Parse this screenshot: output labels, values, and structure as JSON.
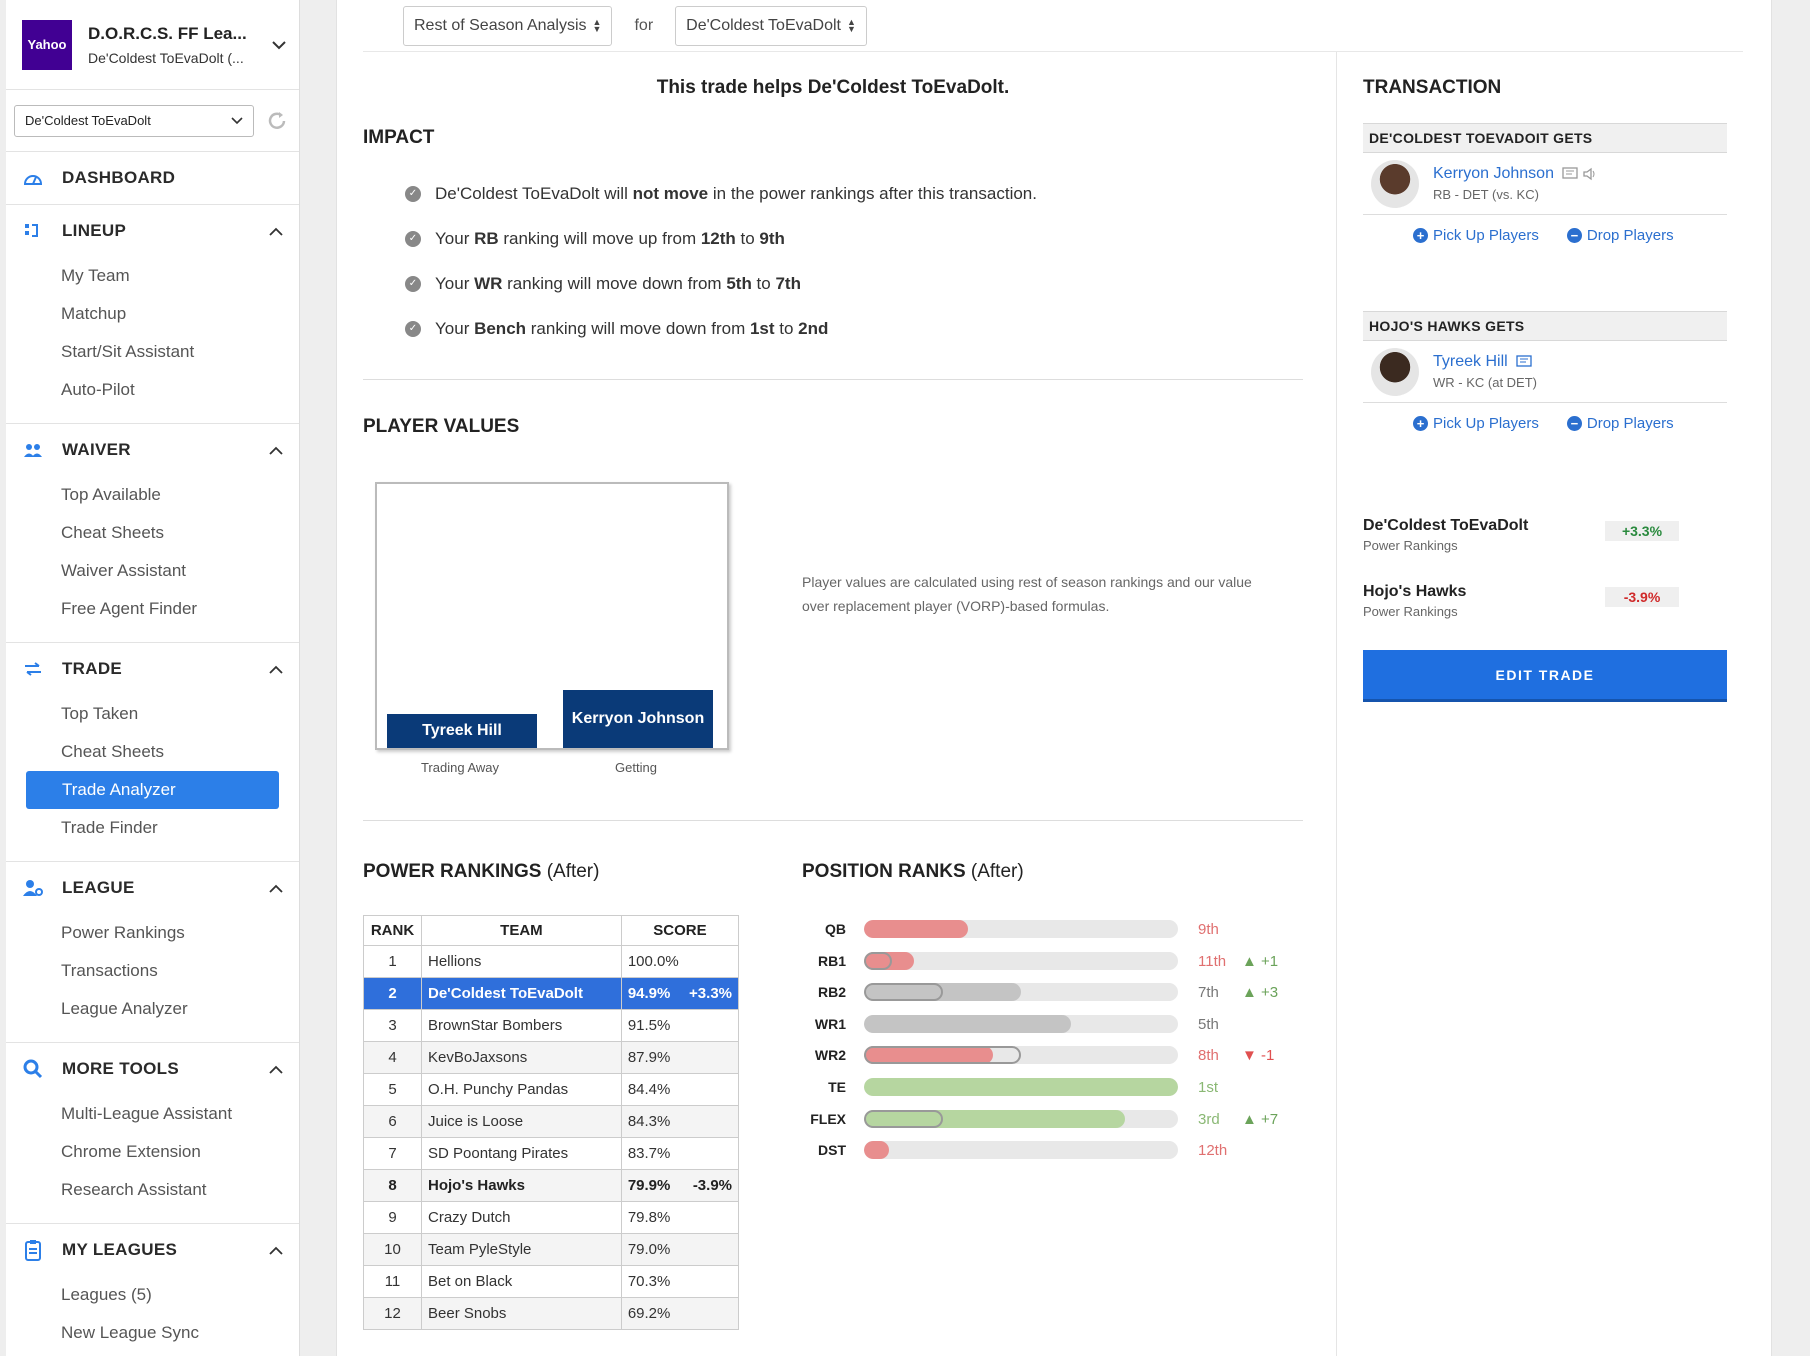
{
  "league": {
    "logo_text": "Yahoo",
    "name": "D.O.R.C.S. FF Lea...",
    "team_short": "De'Coldest ToEvaDolt (..."
  },
  "team_select": {
    "value": "De'Coldest ToEvaDolt"
  },
  "nav": {
    "dashboard": "DASHBOARD",
    "lineup": {
      "label": "LINEUP",
      "items": [
        "My Team",
        "Matchup",
        "Start/Sit Assistant",
        "Auto-Pilot"
      ]
    },
    "waiver": {
      "label": "WAIVER",
      "items": [
        "Top Available",
        "Cheat Sheets",
        "Waiver Assistant",
        "Free Agent Finder"
      ]
    },
    "trade": {
      "label": "TRADE",
      "items": [
        "Top Taken",
        "Cheat Sheets",
        "Trade Analyzer",
        "Trade Finder"
      ]
    },
    "league": {
      "label": "LEAGUE",
      "items": [
        "Power Rankings",
        "Transactions",
        "League Analyzer"
      ]
    },
    "more_tools": {
      "label": "MORE TOOLS",
      "items": [
        "Multi-League Assistant",
        "Chrome Extension",
        "Research Assistant"
      ]
    },
    "my_leagues": {
      "label": "MY LEAGUES",
      "items": [
        "Leagues (5)",
        "New League Sync"
      ]
    }
  },
  "topbar": {
    "analysis": "Rest of Season Analysis",
    "for": "for",
    "team": "De'Coldest ToEvaDolt"
  },
  "summary": "This trade helps De'Coldest ToEvaDolt.",
  "impact": {
    "title": "IMPACT",
    "bullets": [
      {
        "pre": "De'Coldest ToEvaDolt will ",
        "b1": "not move",
        "mid": " in the power rankings after this transaction.",
        "b2": "",
        "post": "",
        "b3": ""
      },
      {
        "pre": "Your ",
        "b1": "RB",
        "mid": " ranking will move up from ",
        "b2": "12th",
        "post": " to ",
        "b3": "9th"
      },
      {
        "pre": "Your ",
        "b1": "WR",
        "mid": " ranking will move down from ",
        "b2": "5th",
        "post": " to ",
        "b3": "7th"
      },
      {
        "pre": "Your ",
        "b1": "Bench",
        "mid": " ranking will move down from ",
        "b2": "1st",
        "post": " to ",
        "b3": "2nd"
      }
    ]
  },
  "player_values": {
    "title": "PLAYER VALUES",
    "note": "Player values are calculated using rest of season rankings and our value over replacement player (VORP)-based formulas.",
    "trading_away": {
      "player": "Tyreek Hill",
      "caption": "Trading Away",
      "value": 0.13
    },
    "getting": {
      "player": "Kerryon Johnson",
      "caption": "Getting",
      "value": 0.22
    }
  },
  "power_rankings": {
    "title": "POWER RANKINGS",
    "suffix": "(After)",
    "headers": [
      "RANK",
      "TEAM",
      "SCORE"
    ],
    "rows": [
      {
        "rank": "1",
        "team": "Hellions",
        "score": "100.0%",
        "chg": ""
      },
      {
        "rank": "2",
        "team": "De'Coldest ToEvaDolt",
        "score": "94.9%",
        "chg": "+3.3%"
      },
      {
        "rank": "3",
        "team": "BrownStar Bombers",
        "score": "91.5%",
        "chg": ""
      },
      {
        "rank": "4",
        "team": "KevBoJaxsons",
        "score": "87.9%",
        "chg": ""
      },
      {
        "rank": "5",
        "team": "O.H. Punchy Pandas",
        "score": "84.4%",
        "chg": ""
      },
      {
        "rank": "6",
        "team": "Juice is Loose",
        "score": "84.3%",
        "chg": ""
      },
      {
        "rank": "7",
        "team": "SD Poontang Pirates",
        "score": "83.7%",
        "chg": ""
      },
      {
        "rank": "8",
        "team": "Hojo's Hawks",
        "score": "79.9%",
        "chg": "-3.9%"
      },
      {
        "rank": "9",
        "team": "Crazy Dutch",
        "score": "79.8%",
        "chg": ""
      },
      {
        "rank": "10",
        "team": "Team PyleStyle",
        "score": "79.0%",
        "chg": ""
      },
      {
        "rank": "11",
        "team": "Bet on Black",
        "score": "70.3%",
        "chg": ""
      },
      {
        "rank": "12",
        "team": "Beer Snobs",
        "score": "69.2%",
        "chg": ""
      }
    ]
  },
  "position_ranks": {
    "title": "POSITION RANKS",
    "suffix": "(After)",
    "colors": {
      "red": "#e88e8e",
      "gray": "#c4c4c4",
      "green": "#b6d6a0",
      "up": "#6ba35a",
      "down": "#e05050"
    },
    "rows": [
      {
        "pos": "QB",
        "rank": "9th",
        "chg": "",
        "dir": "",
        "fill": 0.33,
        "prev": 0,
        "color": "red"
      },
      {
        "pos": "RB1",
        "rank": "11th",
        "chg": "+1",
        "dir": "up",
        "fill": 0.16,
        "prev": 0.09,
        "color": "red"
      },
      {
        "pos": "RB2",
        "rank": "7th",
        "chg": "+3",
        "dir": "up",
        "fill": 0.5,
        "prev": 0.25,
        "color": "gray"
      },
      {
        "pos": "WR1",
        "rank": "5th",
        "chg": "",
        "dir": "",
        "fill": 0.66,
        "prev": 0,
        "color": "gray"
      },
      {
        "pos": "WR2",
        "rank": "8th",
        "chg": "-1",
        "dir": "down",
        "fill": 0.41,
        "prev": 0.5,
        "color": "red"
      },
      {
        "pos": "TE",
        "rank": "1st",
        "chg": "",
        "dir": "",
        "fill": 1.0,
        "prev": 0,
        "color": "green"
      },
      {
        "pos": "FLEX",
        "rank": "3rd",
        "chg": "+7",
        "dir": "up",
        "fill": 0.83,
        "prev": 0.25,
        "color": "green"
      },
      {
        "pos": "DST",
        "rank": "12th",
        "chg": "",
        "dir": "",
        "fill": 0.08,
        "prev": 0,
        "color": "red"
      }
    ]
  },
  "transaction": {
    "title": "TRANSACTION",
    "side1": {
      "head": "DE'COLDEST TOEVADOIT GETS",
      "player": "Kerryon Johnson",
      "sub": "RB - DET (vs. KC)"
    },
    "side2": {
      "head": "HOJO'S HAWKS GETS",
      "player": "Tyreek Hill",
      "sub": "WR - KC (at DET)"
    },
    "pickup": "Pick Up Players",
    "drop": "Drop Players",
    "rank1": {
      "name": "De'Coldest ToEvaDolt",
      "sub": "Power Rankings",
      "pct": "+3.3%",
      "color": "#2a8a3e"
    },
    "rank2": {
      "name": "Hojo's Hawks",
      "sub": "Power Rankings",
      "pct": "-3.9%",
      "color": "#d02a2a"
    },
    "edit": "EDIT TRADE"
  }
}
